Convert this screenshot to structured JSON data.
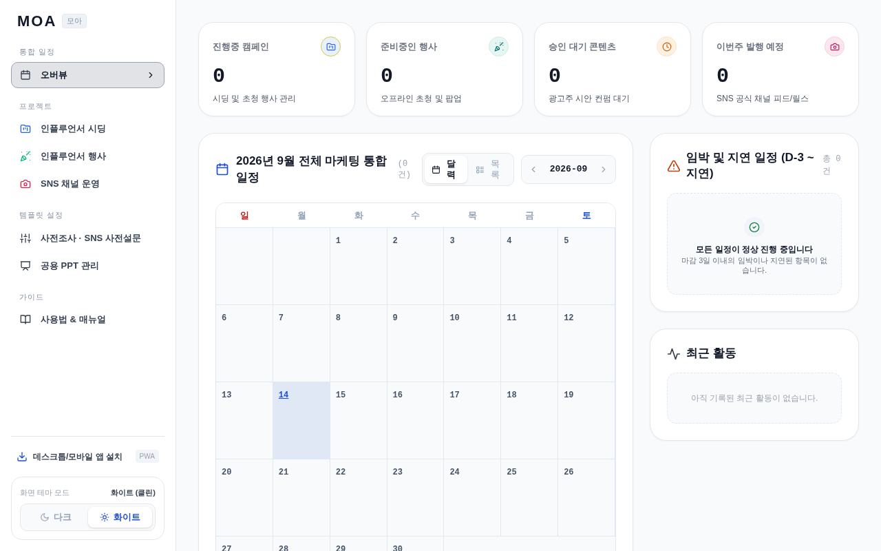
{
  "sidebar": {
    "logo": "MOA",
    "logo_badge": "모아",
    "sections": [
      {
        "label": "통합 일정",
        "items": [
          {
            "label": "오버뷰",
            "selected": true
          }
        ]
      },
      {
        "label": "프로젝트",
        "items": [
          {
            "label": "인플루언서 시딩",
            "selected": false
          },
          {
            "label": "인플루언서 행사",
            "selected": false
          },
          {
            "label": "SNS 채널 운영",
            "selected": false
          }
        ]
      },
      {
        "label": "템플릿 설정",
        "items": [
          {
            "label": "사전조사 · SNS 사전설문",
            "selected": false
          },
          {
            "label": "공용 PPT 관리",
            "selected": false
          }
        ]
      },
      {
        "label": "가이드",
        "items": [
          {
            "label": "사용법 & 매뉴얼",
            "selected": false
          }
        ]
      }
    ],
    "install": {
      "label": "데스크톱/모바일 앱 설치",
      "badge": "PWA"
    },
    "theme": {
      "label": "화면 테마 모드",
      "current": "화이트 (클린)",
      "options": [
        {
          "label": "다크",
          "selected": false
        },
        {
          "label": "화이트",
          "selected": true
        }
      ]
    }
  },
  "stats": [
    {
      "title": "진행중 캠페인",
      "value": "0",
      "caption": "시딩 및 초청 행사 관리"
    },
    {
      "title": "준비중인 행사",
      "value": "0",
      "caption": "오프라인 초청 및 팝업"
    },
    {
      "title": "승인 대기 콘텐츠",
      "value": "0",
      "caption": "광고주 시안 컨펌 대기"
    },
    {
      "title": "이번주 발행 예정",
      "value": "0",
      "caption": "SNS 공식 채널 피드/릴스"
    }
  ],
  "calendar": {
    "title": "2026년 9월 전체 마케팅 통합 일정",
    "count": "(0 건)",
    "views": [
      {
        "label": "달력",
        "selected": true
      },
      {
        "label": "목록",
        "selected": false
      }
    ],
    "month": "2026-09",
    "weekdays": [
      {
        "label": "일",
        "kind": "sunday"
      },
      {
        "label": "월",
        "kind": "weekday"
      },
      {
        "label": "화",
        "kind": "weekday"
      },
      {
        "label": "수",
        "kind": "weekday"
      },
      {
        "label": "목",
        "kind": "weekday"
      },
      {
        "label": "금",
        "kind": "weekday"
      },
      {
        "label": "토",
        "kind": "saturday"
      }
    ],
    "weeks": [
      [
        {
          "day": "1",
          "today": false
        },
        {
          "day": "2",
          "today": false
        },
        {
          "day": "3",
          "today": false
        },
        {
          "day": "4",
          "today": false
        },
        {
          "day": "5",
          "today": false
        }
      ],
      [
        {
          "day": "6",
          "today": false
        },
        {
          "day": "7",
          "today": false
        },
        {
          "day": "8",
          "today": false
        },
        {
          "day": "9",
          "today": false
        },
        {
          "day": "10",
          "today": false
        },
        {
          "day": "11",
          "today": false
        },
        {
          "day": "12",
          "today": false
        }
      ],
      [
        {
          "day": "13",
          "today": false
        },
        {
          "day": "14",
          "today": true
        },
        {
          "day": "15",
          "today": false
        },
        {
          "day": "16",
          "today": false
        },
        {
          "day": "17",
          "today": false
        },
        {
          "day": "18",
          "today": false
        },
        {
          "day": "19",
          "today": false
        }
      ],
      [
        {
          "day": "20",
          "today": false
        },
        {
          "day": "21",
          "today": false
        },
        {
          "day": "22",
          "today": false
        },
        {
          "day": "23",
          "today": false
        },
        {
          "day": "24",
          "today": false
        },
        {
          "day": "25",
          "today": false
        },
        {
          "day": "26",
          "today": false
        }
      ],
      [
        {
          "day": "27",
          "today": false
        },
        {
          "day": "28",
          "today": false
        },
        {
          "day": "29",
          "today": false
        },
        {
          "day": "30",
          "today": false
        }
      ]
    ]
  },
  "deadlines": {
    "title": "임박 및 지연 일정 (D-3 ~ 지연)",
    "count": "총 0 건",
    "empty_title": "모든 일정이 정상 진행 중입니다",
    "empty_text": "마감 3일 이내의 임박이나 지연된 항목이 없습니다."
  },
  "activity": {
    "title": "최근 활동",
    "empty_text": "아직 기록된 최근 활동이 없습니다."
  }
}
